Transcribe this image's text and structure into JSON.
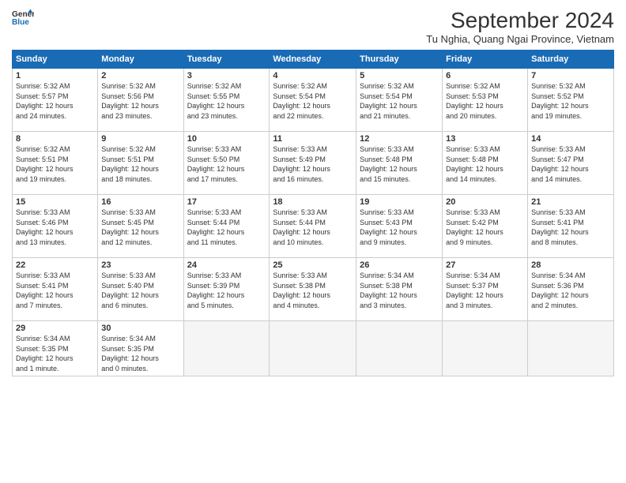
{
  "header": {
    "logo_line1": "General",
    "logo_line2": "Blue",
    "month": "September 2024",
    "location": "Tu Nghia, Quang Ngai Province, Vietnam"
  },
  "weekdays": [
    "Sunday",
    "Monday",
    "Tuesday",
    "Wednesday",
    "Thursday",
    "Friday",
    "Saturday"
  ],
  "weeks": [
    [
      {
        "day": "1",
        "info": "Sunrise: 5:32 AM\nSunset: 5:57 PM\nDaylight: 12 hours\nand 24 minutes."
      },
      {
        "day": "2",
        "info": "Sunrise: 5:32 AM\nSunset: 5:56 PM\nDaylight: 12 hours\nand 23 minutes."
      },
      {
        "day": "3",
        "info": "Sunrise: 5:32 AM\nSunset: 5:55 PM\nDaylight: 12 hours\nand 23 minutes."
      },
      {
        "day": "4",
        "info": "Sunrise: 5:32 AM\nSunset: 5:54 PM\nDaylight: 12 hours\nand 22 minutes."
      },
      {
        "day": "5",
        "info": "Sunrise: 5:32 AM\nSunset: 5:54 PM\nDaylight: 12 hours\nand 21 minutes."
      },
      {
        "day": "6",
        "info": "Sunrise: 5:32 AM\nSunset: 5:53 PM\nDaylight: 12 hours\nand 20 minutes."
      },
      {
        "day": "7",
        "info": "Sunrise: 5:32 AM\nSunset: 5:52 PM\nDaylight: 12 hours\nand 19 minutes."
      }
    ],
    [
      {
        "day": "8",
        "info": "Sunrise: 5:32 AM\nSunset: 5:51 PM\nDaylight: 12 hours\nand 19 minutes."
      },
      {
        "day": "9",
        "info": "Sunrise: 5:32 AM\nSunset: 5:51 PM\nDaylight: 12 hours\nand 18 minutes."
      },
      {
        "day": "10",
        "info": "Sunrise: 5:33 AM\nSunset: 5:50 PM\nDaylight: 12 hours\nand 17 minutes."
      },
      {
        "day": "11",
        "info": "Sunrise: 5:33 AM\nSunset: 5:49 PM\nDaylight: 12 hours\nand 16 minutes."
      },
      {
        "day": "12",
        "info": "Sunrise: 5:33 AM\nSunset: 5:48 PM\nDaylight: 12 hours\nand 15 minutes."
      },
      {
        "day": "13",
        "info": "Sunrise: 5:33 AM\nSunset: 5:48 PM\nDaylight: 12 hours\nand 14 minutes."
      },
      {
        "day": "14",
        "info": "Sunrise: 5:33 AM\nSunset: 5:47 PM\nDaylight: 12 hours\nand 14 minutes."
      }
    ],
    [
      {
        "day": "15",
        "info": "Sunrise: 5:33 AM\nSunset: 5:46 PM\nDaylight: 12 hours\nand 13 minutes."
      },
      {
        "day": "16",
        "info": "Sunrise: 5:33 AM\nSunset: 5:45 PM\nDaylight: 12 hours\nand 12 minutes."
      },
      {
        "day": "17",
        "info": "Sunrise: 5:33 AM\nSunset: 5:44 PM\nDaylight: 12 hours\nand 11 minutes."
      },
      {
        "day": "18",
        "info": "Sunrise: 5:33 AM\nSunset: 5:44 PM\nDaylight: 12 hours\nand 10 minutes."
      },
      {
        "day": "19",
        "info": "Sunrise: 5:33 AM\nSunset: 5:43 PM\nDaylight: 12 hours\nand 9 minutes."
      },
      {
        "day": "20",
        "info": "Sunrise: 5:33 AM\nSunset: 5:42 PM\nDaylight: 12 hours\nand 9 minutes."
      },
      {
        "day": "21",
        "info": "Sunrise: 5:33 AM\nSunset: 5:41 PM\nDaylight: 12 hours\nand 8 minutes."
      }
    ],
    [
      {
        "day": "22",
        "info": "Sunrise: 5:33 AM\nSunset: 5:41 PM\nDaylight: 12 hours\nand 7 minutes."
      },
      {
        "day": "23",
        "info": "Sunrise: 5:33 AM\nSunset: 5:40 PM\nDaylight: 12 hours\nand 6 minutes."
      },
      {
        "day": "24",
        "info": "Sunrise: 5:33 AM\nSunset: 5:39 PM\nDaylight: 12 hours\nand 5 minutes."
      },
      {
        "day": "25",
        "info": "Sunrise: 5:33 AM\nSunset: 5:38 PM\nDaylight: 12 hours\nand 4 minutes."
      },
      {
        "day": "26",
        "info": "Sunrise: 5:34 AM\nSunset: 5:38 PM\nDaylight: 12 hours\nand 3 minutes."
      },
      {
        "day": "27",
        "info": "Sunrise: 5:34 AM\nSunset: 5:37 PM\nDaylight: 12 hours\nand 3 minutes."
      },
      {
        "day": "28",
        "info": "Sunrise: 5:34 AM\nSunset: 5:36 PM\nDaylight: 12 hours\nand 2 minutes."
      }
    ],
    [
      {
        "day": "29",
        "info": "Sunrise: 5:34 AM\nSunset: 5:35 PM\nDaylight: 12 hours\nand 1 minute."
      },
      {
        "day": "30",
        "info": "Sunrise: 5:34 AM\nSunset: 5:35 PM\nDaylight: 12 hours\nand 0 minutes."
      },
      {
        "day": "",
        "info": ""
      },
      {
        "day": "",
        "info": ""
      },
      {
        "day": "",
        "info": ""
      },
      {
        "day": "",
        "info": ""
      },
      {
        "day": "",
        "info": ""
      }
    ]
  ]
}
